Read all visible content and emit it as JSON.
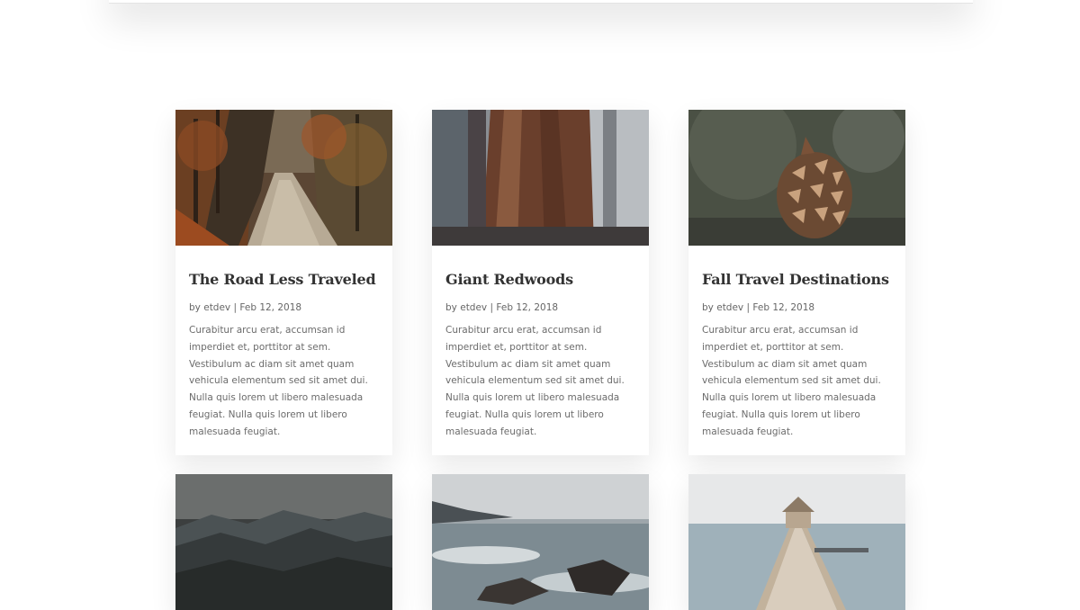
{
  "posts": [
    {
      "title": "The Road Less Traveled",
      "author_prefix": "by",
      "author": "etdev",
      "separator": "|",
      "date": "Feb 12, 2018",
      "excerpt": "Curabitur arcu erat, accumsan id imperdiet et, porttitor at sem. Vestibulum ac diam sit amet quam vehicula elementum sed sit amet dui. Nulla quis lorem ut libero malesuada feugiat. Nulla quis lorem ut libero malesuada feugiat."
    },
    {
      "title": "Giant Redwoods",
      "author_prefix": "by",
      "author": "etdev",
      "separator": "|",
      "date": "Feb 12, 2018",
      "excerpt": "Curabitur arcu erat, accumsan id imperdiet et, porttitor at sem. Vestibulum ac diam sit amet quam vehicula elementum sed sit amet dui. Nulla quis lorem ut libero malesuada feugiat. Nulla quis lorem ut libero malesuada feugiat."
    },
    {
      "title": "Fall Travel Destinations",
      "author_prefix": "by",
      "author": "etdev",
      "separator": "|",
      "date": "Feb 12, 2018",
      "excerpt": "Curabitur arcu erat, accumsan id imperdiet et, porttitor at sem. Vestibulum ac diam sit amet quam vehicula elementum sed sit amet dui. Nulla quis lorem ut libero malesuada feugiat. Nulla quis lorem ut libero malesuada feugiat."
    }
  ],
  "colors": {
    "title": "#333333",
    "meta": "#666666",
    "excerpt": "#6b6b6b",
    "card_background": "#ffffff"
  }
}
